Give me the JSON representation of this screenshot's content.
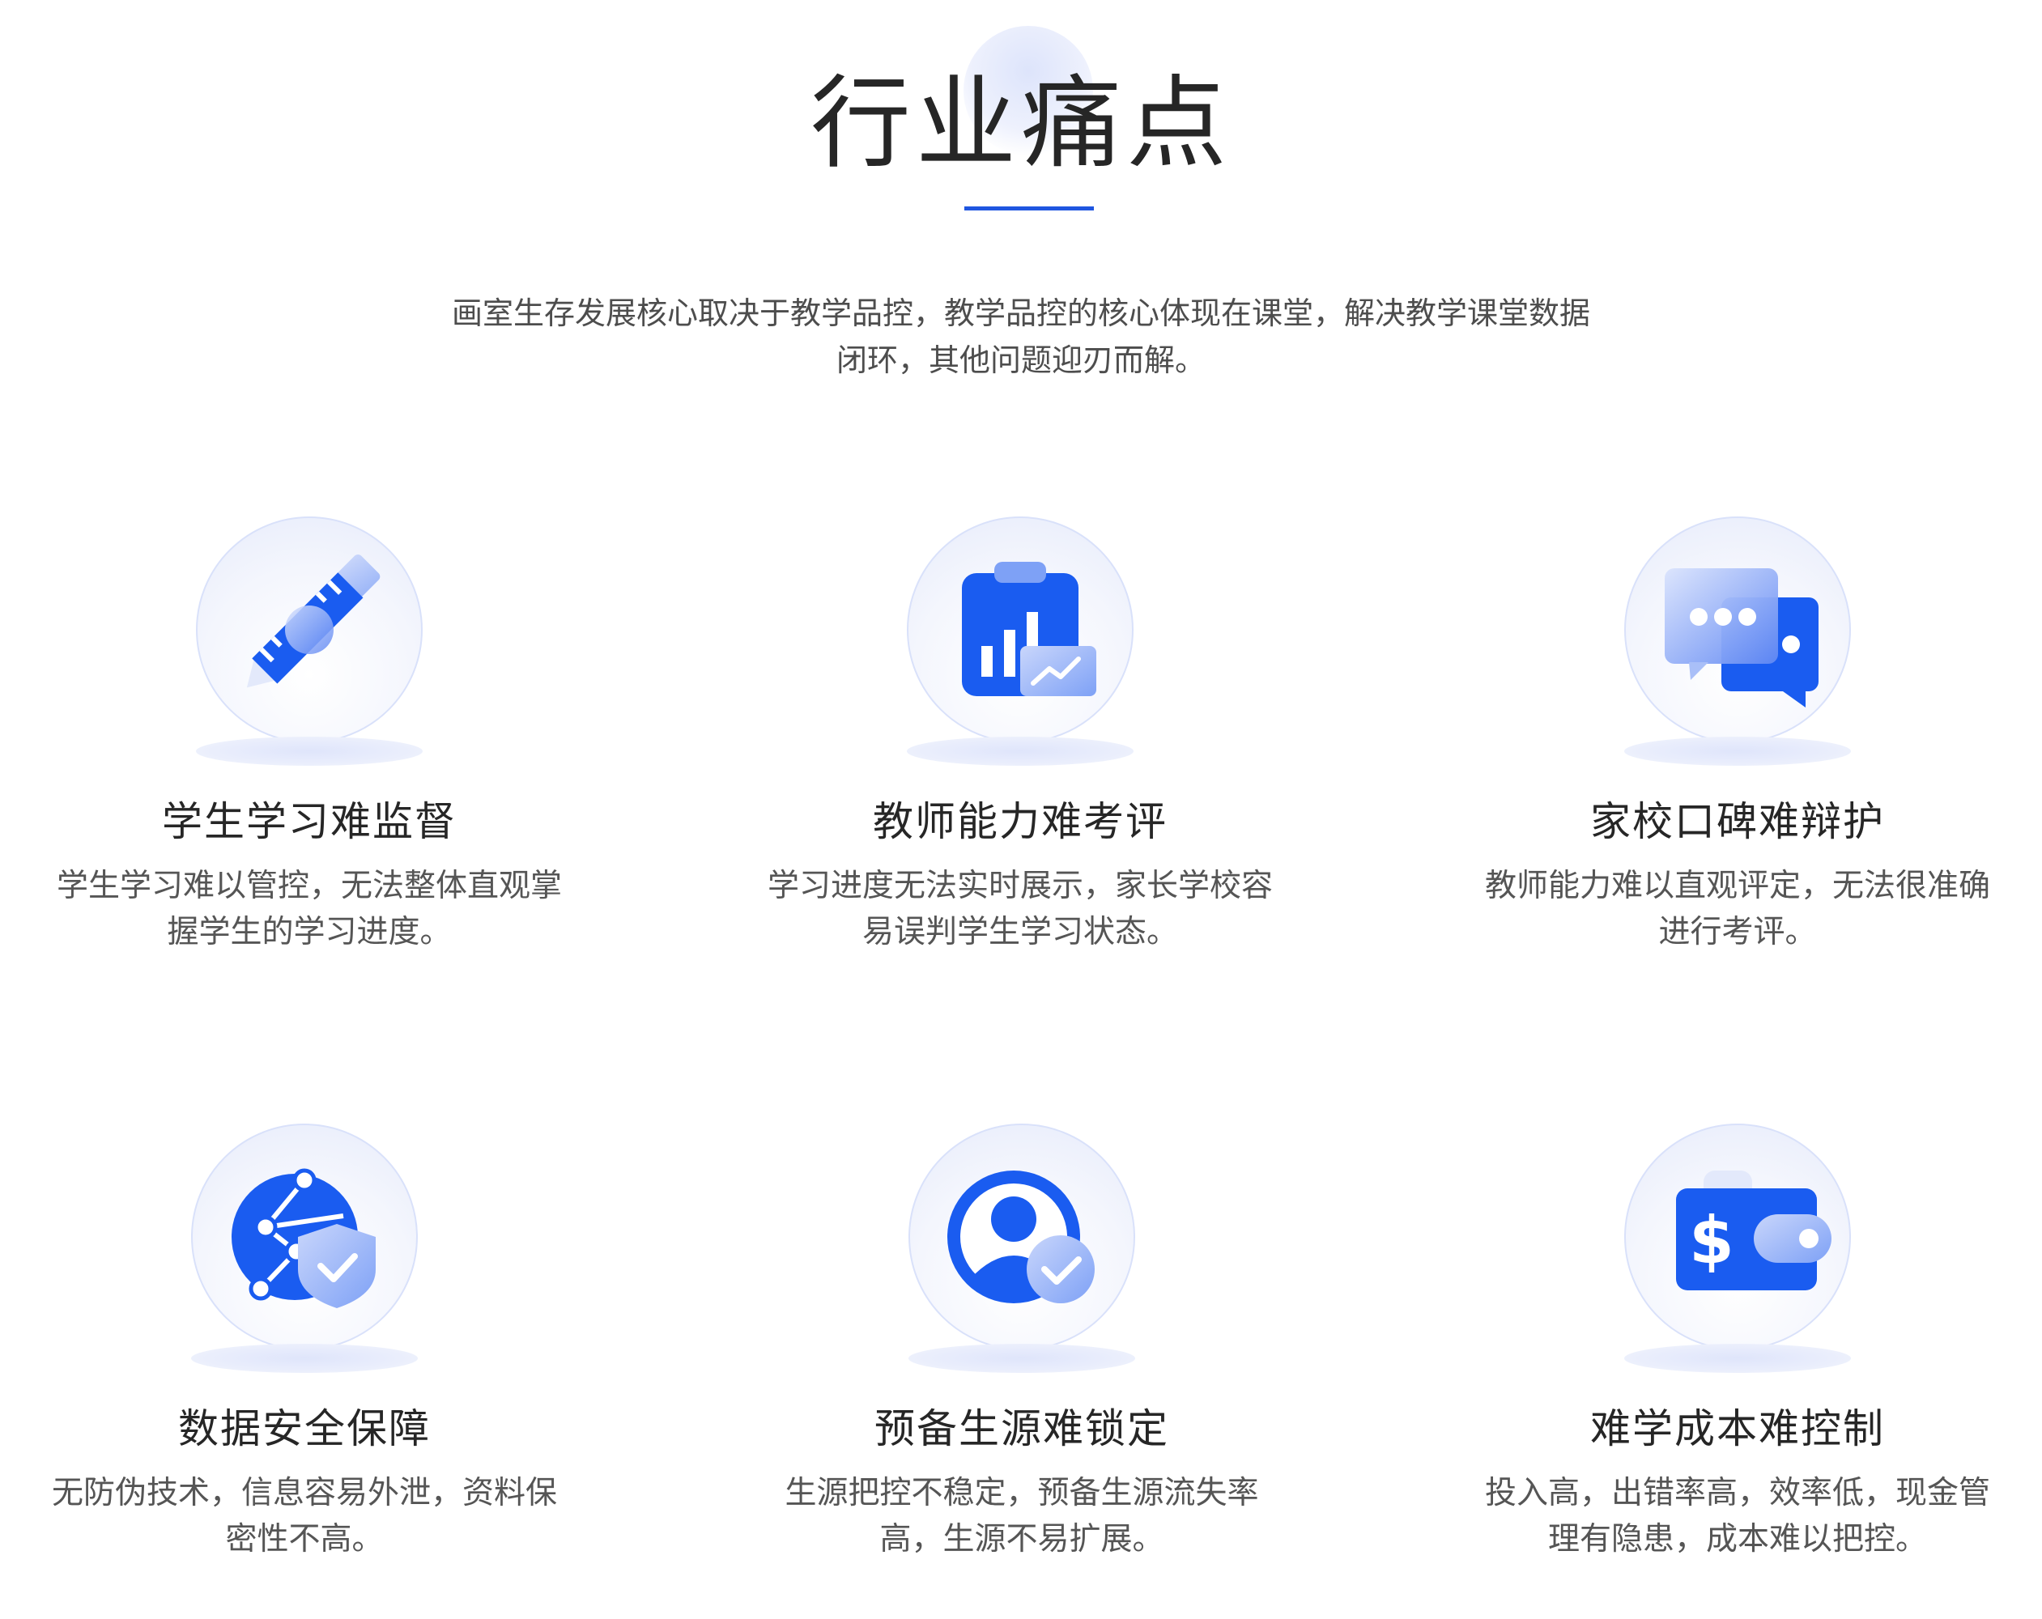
{
  "header": {
    "title": "行业痛点",
    "intro_line1": "画室生存发展核心取决于教学品控，教学品控的核心体现在课堂，解决教学课堂数据",
    "intro_line2": "闭环，其他问题迎刃而解。"
  },
  "cards": [
    {
      "icon": "pencil-ruler-icon",
      "title": "学生学习难监督",
      "desc_line1": "学生学习难以管控，无法整体直观掌",
      "desc_line2": "握学生的学习进度。"
    },
    {
      "icon": "clipboard-chart-icon",
      "title": "教师能力难考评",
      "desc_line1": "学习进度无法实时展示，家长学校容",
      "desc_line2": "易误判学生学习状态。"
    },
    {
      "icon": "chat-bubbles-icon",
      "title": "家校口碑难辩护",
      "desc_line1": "教师能力难以直观评定，无法很准确",
      "desc_line2": "进行考评。"
    },
    {
      "icon": "globe-shield-icon",
      "title": "数据安全保障",
      "desc_line1": "无防伪技术，信息容易外泄，资料保",
      "desc_line2": "密性不高。"
    },
    {
      "icon": "user-check-icon",
      "title": "预备生源难锁定",
      "desc_line1": "生源把控不稳定，预备生源流失率",
      "desc_line2": "高，生源不易扩展。"
    },
    {
      "icon": "wallet-dollar-icon",
      "title": "难学成本难控制",
      "desc_line1": "投入高，出错率高，效率低，现金管",
      "desc_line2": "理有隐患，成本难以把控。"
    }
  ],
  "colors": {
    "accent": "#1f56e0",
    "icon_blue": "#1a5cf0",
    "title_text": "#262626",
    "body_text": "#555555"
  }
}
